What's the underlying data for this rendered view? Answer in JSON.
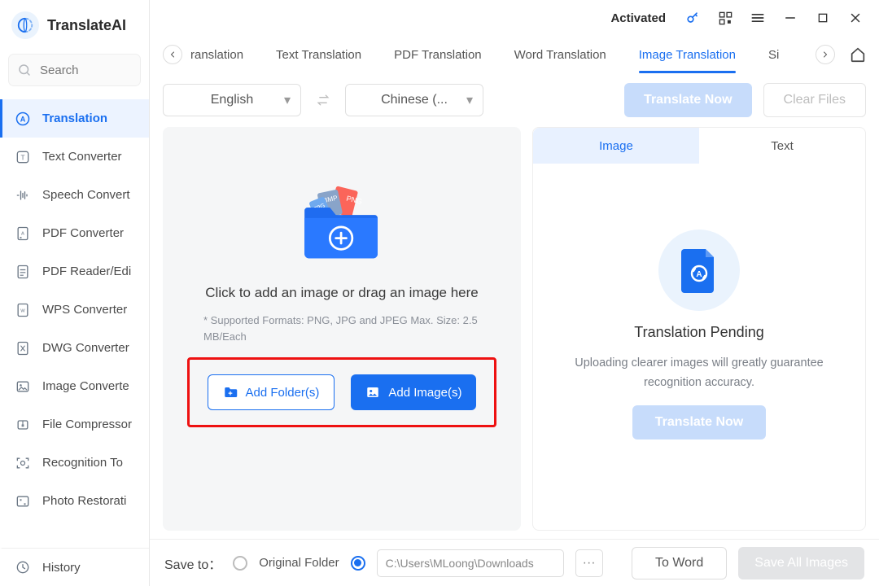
{
  "app": {
    "name": "TranslateAI"
  },
  "header": {
    "activated": "Activated"
  },
  "search": {
    "placeholder": "Search"
  },
  "sidebar": {
    "items": [
      {
        "label": "Translation"
      },
      {
        "label": "Text Converter"
      },
      {
        "label": "Speech Convert"
      },
      {
        "label": "PDF Converter"
      },
      {
        "label": "PDF Reader/Edi"
      },
      {
        "label": "WPS Converter"
      },
      {
        "label": "DWG Converter"
      },
      {
        "label": "Image Converte"
      },
      {
        "label": "File Compressor"
      },
      {
        "label": "Recognition To"
      },
      {
        "label": "Photo Restorati"
      }
    ],
    "history_label": "History"
  },
  "tabs": {
    "partial_left": "ranslation",
    "items": [
      {
        "label": "Text Translation"
      },
      {
        "label": "PDF Translation"
      },
      {
        "label": "Word Translation"
      },
      {
        "label": "Image Translation"
      }
    ],
    "partial_right": "Si"
  },
  "lang": {
    "source": "English",
    "target": "Chinese (...",
    "translate_now": "Translate Now",
    "clear_files": "Clear Files"
  },
  "drop": {
    "title": "Click to add an image or drag an image here",
    "sub": "* Supported Formats: PNG, JPG and JPEG Max. Size: 2.5 MB/Each",
    "add_folder": "Add Folder(s)",
    "add_image": "Add Image(s)"
  },
  "preview": {
    "tab_image": "Image",
    "tab_text": "Text",
    "pending_title": "Translation Pending",
    "pending_sub": "Uploading clearer images will greatly guarantee recognition accuracy.",
    "translate_now": "Translate Now"
  },
  "footer": {
    "save_to": "Save to：",
    "original_folder": "Original Folder",
    "path": "C:\\Users\\MLoong\\Downloads",
    "to_word": "To Word",
    "save_all": "Save All Images"
  }
}
